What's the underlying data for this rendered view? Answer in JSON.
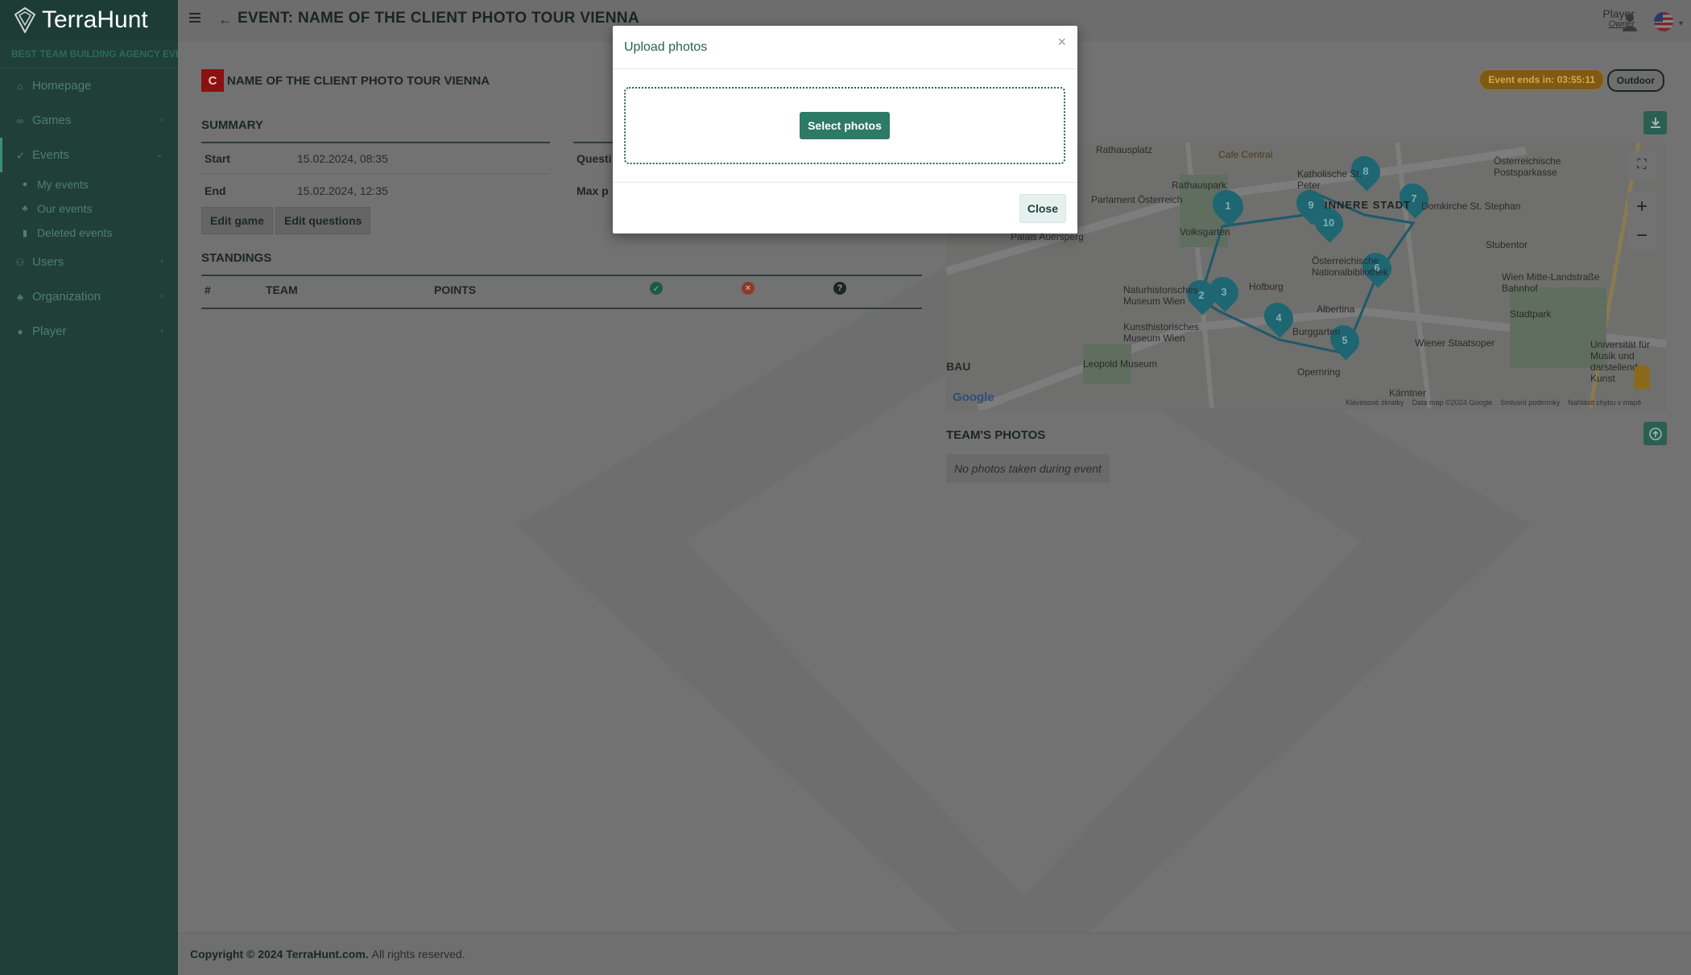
{
  "app": {
    "name": "TerraHunt",
    "agency": "BEST TEAM BUILDING AGENCY EVENTS"
  },
  "sidebar": {
    "items": [
      {
        "label": "Homepage",
        "icon": "home-icon"
      },
      {
        "label": "Games",
        "icon": "gamepad-icon"
      },
      {
        "label": "Events",
        "icon": "rocket-icon"
      },
      {
        "label": "Users",
        "icon": "users-icon"
      },
      {
        "label": "Organization",
        "icon": "sitemap-icon"
      },
      {
        "label": "Player",
        "icon": "user-icon"
      }
    ],
    "events_sub": [
      {
        "label": "My events"
      },
      {
        "label": "Our events"
      },
      {
        "label": "Deleted events"
      }
    ]
  },
  "header": {
    "title": "EVENT: NAME OF THE CLIENT PHOTO TOUR VIENNA",
    "user_name": "Player",
    "user_role": "Owner"
  },
  "event": {
    "badge": "C",
    "name": "NAME OF THE CLIENT PHOTO TOUR VIENNA",
    "ends_in": "Event ends in: 03:55:11",
    "type": "Outdoor"
  },
  "summary": {
    "title": "SUMMARY",
    "start_label": "Start",
    "start_value": "15.02.2024, 08:35",
    "end_label": "End",
    "end_value": "15.02.2024, 12:35",
    "questions_label": "Questi",
    "maxp_label": "Max p",
    "edit_game": "Edit game",
    "edit_questions": "Edit questions"
  },
  "standings": {
    "title": "STANDINGS",
    "columns": [
      "#",
      "TEAM",
      "POINTS"
    ]
  },
  "map": {
    "labels": [
      "Rathausplatz",
      "Cafe Central",
      "Katholische St. Peter",
      "Österreichische Postsparkasse",
      "Rathauspark",
      "Parlament Österreich",
      "INNERE STADT",
      "Domkirche St. Stephan",
      "Volksgarten",
      "Palais Auersperg",
      "Österreichische Nationalbibliothek",
      "Stubentor",
      "Hofburg",
      "Naturhistorisches Museum Wien",
      "Albertina",
      "Wien Mitte-Landstraße Bahnhof",
      "Kunsthistorisches Museum Wien",
      "Burggarten",
      "Stadtpark",
      "Wiener Staatsoper",
      "Universität für Musik und darstellende Kunst",
      "Leopold Museum",
      "Opernring",
      "Kärntner",
      "BAU",
      "Google"
    ],
    "attribution": [
      "Klávesové zkratky",
      "Data map ©2024 Google",
      "Smluvní podmínky",
      "Nahlásit chybu v mapě"
    ],
    "markers": [
      "1",
      "2",
      "3",
      "4",
      "5",
      "6",
      "7",
      "8",
      "9",
      "10"
    ]
  },
  "photos": {
    "title": "TEAM'S PHOTOS",
    "empty": "No photos taken during event"
  },
  "footer": {
    "copyright": "Copyright © 2024 TerraHunt.com.",
    "rights": "All rights reserved."
  },
  "modal": {
    "title": "Upload photos",
    "close_x": "×",
    "select": "Select photos",
    "close": "Close"
  }
}
